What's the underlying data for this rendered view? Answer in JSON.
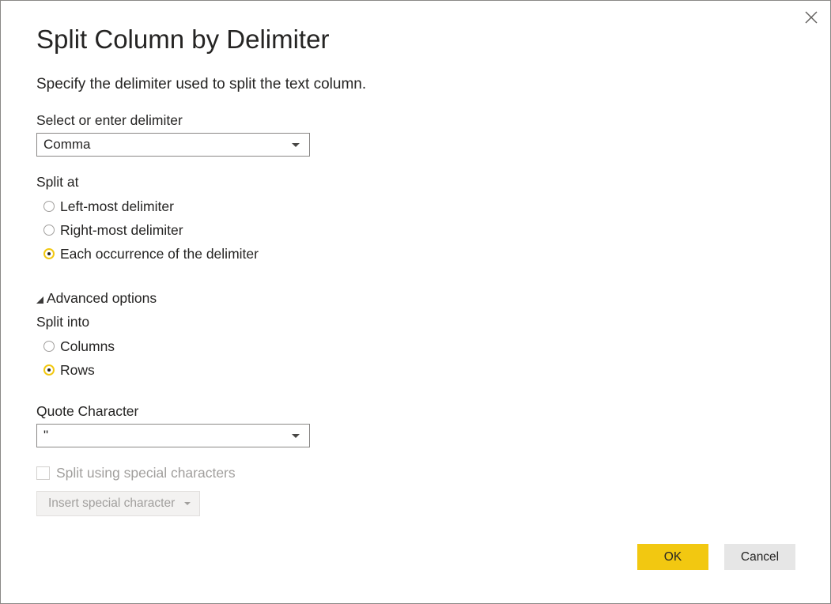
{
  "dialog": {
    "title": "Split Column by Delimiter",
    "subtitle": "Specify the delimiter used to split the text column."
  },
  "delimiter": {
    "label": "Select or enter delimiter",
    "value": "Comma"
  },
  "split_at": {
    "label": "Split at",
    "options": [
      {
        "label": "Left-most delimiter",
        "checked": false
      },
      {
        "label": "Right-most delimiter",
        "checked": false
      },
      {
        "label": "Each occurrence of the delimiter",
        "checked": true
      }
    ]
  },
  "advanced": {
    "toggle_label": "Advanced options",
    "expanded": true,
    "split_into": {
      "label": "Split into",
      "options": [
        {
          "label": "Columns",
          "checked": false
        },
        {
          "label": "Rows",
          "checked": true
        }
      ]
    },
    "quote_character": {
      "label": "Quote Character",
      "value": "\""
    },
    "special_chars": {
      "checkbox_label": "Split using special characters",
      "checked": false,
      "insert_button_label": "Insert special character"
    }
  },
  "buttons": {
    "ok": "OK",
    "cancel": "Cancel"
  },
  "colors": {
    "accent": "#f2c811",
    "text": "#252423",
    "disabled_text": "#a19f9d",
    "cancel_bg": "#e6e6e6"
  },
  "icons": {
    "close": "close-icon",
    "dropdown": "chevron-down-icon",
    "expand": "triangle-expanded-icon"
  }
}
